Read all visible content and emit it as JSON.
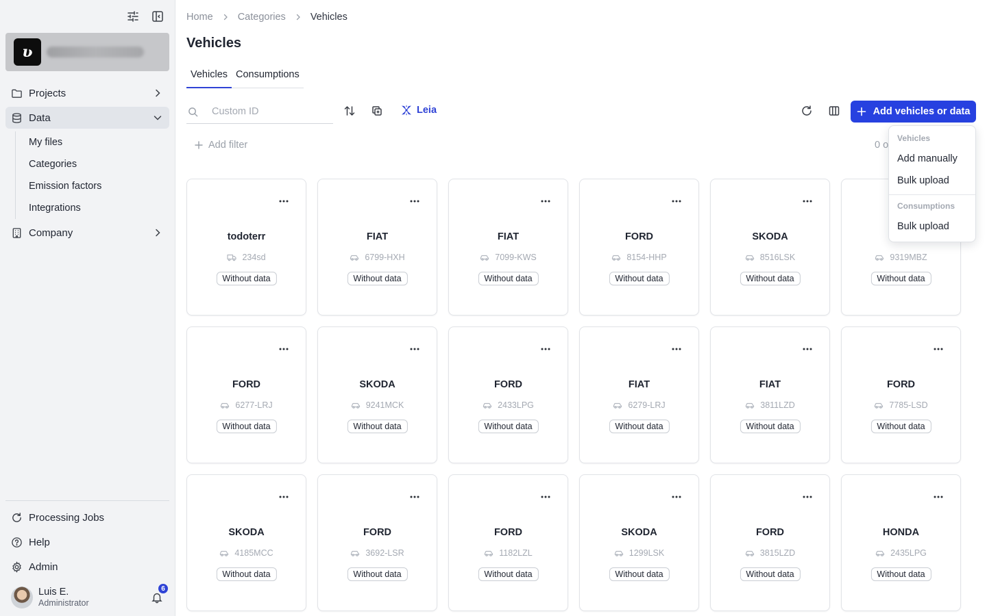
{
  "sidebar": {
    "nav": [
      {
        "label": "Projects",
        "icon": "folder-icon",
        "expanded": false
      },
      {
        "label": "Data",
        "icon": "database-icon",
        "expanded": true
      },
      {
        "label": "Company",
        "icon": "building-icon",
        "expanded": false
      }
    ],
    "data_sub": [
      "My files",
      "Categories",
      "Emission factors",
      "Integrations"
    ],
    "bottom": [
      {
        "label": "Processing Jobs",
        "icon": "refresh-icon"
      },
      {
        "label": "Help",
        "icon": "help-icon"
      },
      {
        "label": "Admin",
        "icon": "gear-icon"
      }
    ],
    "user": {
      "name": "Luis E.",
      "role": "Administrator",
      "notifications": "6"
    }
  },
  "breadcrumb": [
    "Home",
    "Categories",
    "Vehicles"
  ],
  "page_title": "Vehicles",
  "tabs": [
    "Vehicles",
    "Consumptions"
  ],
  "search": {
    "placeholder": "Custom ID",
    "value": ""
  },
  "leia_label": "Leia",
  "add_button_label": "Add vehicles or data",
  "add_filter_label": "Add filter",
  "result_count": "0 of",
  "dropdown": {
    "group1": "Vehicles",
    "group1_items": [
      "Add manually",
      "Bulk upload"
    ],
    "group2": "Consumptions",
    "group2_items": [
      "Bulk upload"
    ]
  },
  "vehicles": [
    {
      "brand": "todoterr",
      "plate": "234sd",
      "status": "Without data",
      "icon": "truck-icon"
    },
    {
      "brand": "FIAT",
      "plate": "6799-HXH",
      "status": "Without data",
      "icon": "car-icon"
    },
    {
      "brand": "FIAT",
      "plate": "7099-KWS",
      "status": "Without data",
      "icon": "car-icon"
    },
    {
      "brand": "FORD",
      "plate": "8154-HHP",
      "status": "Without data",
      "icon": "car-icon"
    },
    {
      "brand": "SKODA",
      "plate": "8516LSK",
      "status": "Without data",
      "icon": "car-icon"
    },
    {
      "brand": "",
      "plate": "9319MBZ",
      "status": "Without data",
      "icon": "car-icon"
    },
    {
      "brand": "FORD",
      "plate": "6277-LRJ",
      "status": "Without data",
      "icon": "car-icon"
    },
    {
      "brand": "SKODA",
      "plate": "9241MCK",
      "status": "Without data",
      "icon": "car-icon"
    },
    {
      "brand": "FORD",
      "plate": "2433LPG",
      "status": "Without data",
      "icon": "car-icon"
    },
    {
      "brand": "FIAT",
      "plate": "6279-LRJ",
      "status": "Without data",
      "icon": "car-icon"
    },
    {
      "brand": "FIAT",
      "plate": "3811LZD",
      "status": "Without data",
      "icon": "car-icon"
    },
    {
      "brand": "FORD",
      "plate": "7785-LSD",
      "status": "Without data",
      "icon": "car-icon"
    },
    {
      "brand": "SKODA",
      "plate": "4185MCC",
      "status": "Without data",
      "icon": "car-icon"
    },
    {
      "brand": "FORD",
      "plate": "3692-LSR",
      "status": "Without data",
      "icon": "car-icon"
    },
    {
      "brand": "FORD",
      "plate": "1182LZL",
      "status": "Without data",
      "icon": "car-icon"
    },
    {
      "brand": "SKODA",
      "plate": "1299LSK",
      "status": "Without data",
      "icon": "car-icon"
    },
    {
      "brand": "FORD",
      "plate": "3815LZD",
      "status": "Without data",
      "icon": "car-icon"
    },
    {
      "brand": "HONDA",
      "plate": "2435LPG",
      "status": "Without data",
      "icon": "car-icon"
    }
  ],
  "colors": {
    "accent": "#2741e0",
    "sidebar_bg": "#f2f3f5",
    "active_nav": "#e2e5ea"
  }
}
